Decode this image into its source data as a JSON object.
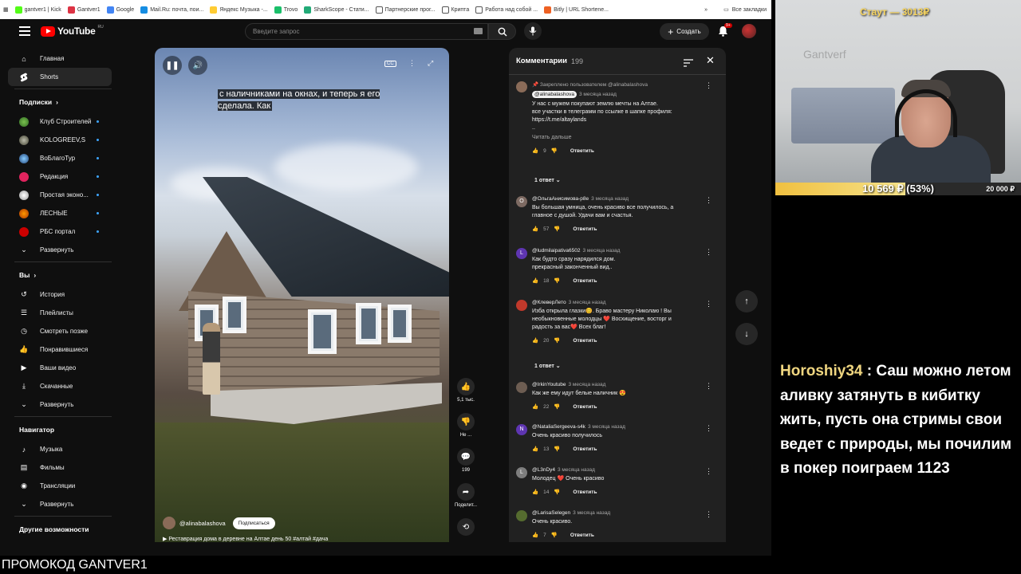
{
  "bookmarks": [
    "gantver1 | Kick",
    "Gantver1",
    "Google",
    "Mail.Ru: почта, пои...",
    "Яндекс Музыка -...",
    "Trovo",
    "SharkScope - Стати...",
    "Партнерские прог...",
    "Крипта",
    "Работа над собой ...",
    "Bitly | URL Shortene..."
  ],
  "bookmarks_right": "Все закладки",
  "header": {
    "logo": "YouTube",
    "logo_region": "RU",
    "search_placeholder": "Введите запрос",
    "create_label": "Создать",
    "notif_count": "9+"
  },
  "sidebar": {
    "main": [
      {
        "label": "Главная",
        "icon": "home-icon"
      },
      {
        "label": "Shorts",
        "icon": "shorts-icon"
      }
    ],
    "subs_title": "Подписки",
    "subs": [
      "Клуб Строителей",
      "KOLOGREEV,S",
      "ВоБлагоТур",
      "Редакция",
      "Простая эконо...",
      "ЛЕСНЫЕ",
      "РБС портал"
    ],
    "subs_more": "Развернуть",
    "you_title": "Вы",
    "you": [
      "История",
      "Плейлисты",
      "Смотреть позже",
      "Понравившиеся",
      "Ваши видео",
      "Скачанные",
      "Развернуть"
    ],
    "nav_title": "Навигатор",
    "nav": [
      "Музыка",
      "Фильмы",
      "Трансляции",
      "Развернуть"
    ],
    "more_title": "Другие возможности"
  },
  "video": {
    "caption": "с наличниками на окнах, и теперь я его сделала. Как",
    "channel": "@alinabalashova",
    "subscribe": "Подписаться",
    "title": "Реставрация дома в деревне на Алтае день 50 #алтай #дача"
  },
  "actions": {
    "likes": "5,1 тыс.",
    "dislike": "Не ...",
    "comments": "199",
    "share": "Поделит..."
  },
  "comments": {
    "title": "Комментарии",
    "count": "199",
    "items": [
      {
        "pinned": "Закреплено пользователем @alinabalashova",
        "author": "@alinabalashova",
        "time": "3 месяца назад",
        "lines": [
          "У нас с мужем покупают землю мечты на Алтае.",
          "все участки в телеграмм по ссылке в шапке профиля:",
          "https://t.me/altaylands",
          "..",
          "Читать дальше"
        ],
        "likes": "9",
        "reply": "Ответить",
        "replies": "1 ответ"
      },
      {
        "author": "@ОльгаАнисимова-р8е",
        "time": "3 месяца назад",
        "lines": [
          "Вы большая умница, очень красиво все получилось, а",
          "главное с душой. Удачи вам и счастья."
        ],
        "likes": "57",
        "reply": "Ответить"
      },
      {
        "author": "@ludmilaipativa6502",
        "time": "3 месяца назад",
        "lines": [
          "Как будто сразу нарядился дом.",
          "прекрасный законченный вид.."
        ],
        "likes": "18",
        "reply": "Ответить"
      },
      {
        "author": "@КлеверЛето",
        "time": "3 месяца назад",
        "lines": [
          "Изба открыла глазки😊. Браво мастеру Николаю ! Вы",
          "необыкновенные молодцы ❤️ Восхищение, восторг и",
          "радость за вас❤️ Всех благ!"
        ],
        "likes": "20",
        "reply": "Ответить",
        "replies": "1 ответ"
      },
      {
        "author": "@IrkinYoutube",
        "time": "3 месяца назад",
        "lines": [
          "Как же ему идут белые наличник 😍"
        ],
        "likes": "22",
        "reply": "Ответить"
      },
      {
        "author": "@NataliaSergeeva-s4k",
        "time": "3 месяца назад",
        "lines": [
          "Очень красиво получилось"
        ],
        "likes": "13",
        "reply": "Ответить"
      },
      {
        "author": "@L3nDy4",
        "time": "3 месяца назад",
        "lines": [
          "Молодец ❤️ Очень красиво"
        ],
        "likes": "14",
        "reply": "Ответить"
      },
      {
        "author": "@LarisaSelegen",
        "time": "3 месяца назад",
        "lines": [
          "Очень красиво."
        ],
        "likes": "7",
        "reply": "Ответить"
      }
    ]
  },
  "stream": {
    "top_label": "Стаут — 3013₽",
    "watermark": "Gantverf",
    "goal_text": "10 569 ₽ (53%)",
    "goal_max": "20 000 ₽",
    "goal_fraction": 0.53,
    "chat_user": "Horoshiy34",
    "chat_message": "Саш можно летом аливку затянуть в кибитку жить, пусть она стримы свои ведет с природы, мы почилим в покер поиграем 1123",
    "promo": "ПРОМОКОД GANTVER1"
  },
  "colors": {
    "yt_bg": "#0f0f0f",
    "panel": "#212121",
    "accent_red": "#ff0000",
    "goal": "#f0c040"
  }
}
